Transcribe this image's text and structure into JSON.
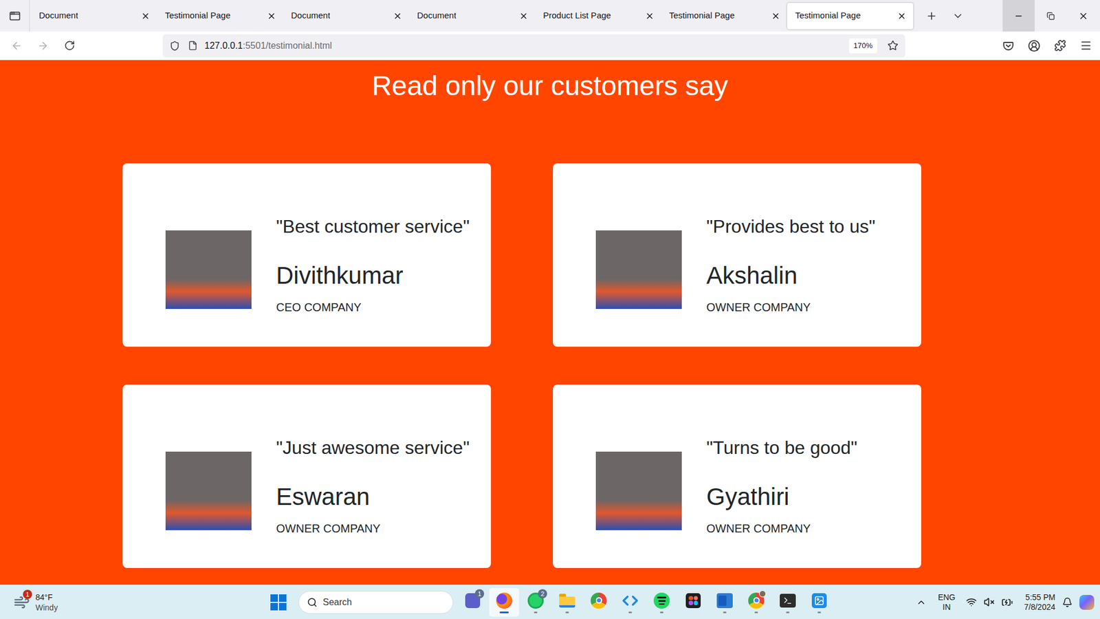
{
  "browser": {
    "tabs": [
      {
        "label": "Document",
        "selected": false
      },
      {
        "label": "Testimonial Page",
        "selected": false
      },
      {
        "label": "Document",
        "selected": false
      },
      {
        "label": "Document",
        "selected": false
      },
      {
        "label": "Product List Page",
        "selected": false
      },
      {
        "label": "Testimonial Page",
        "selected": false
      },
      {
        "label": "Testimonial Page",
        "selected": true
      }
    ],
    "address": {
      "host": "127.0.0.1",
      "rest": ":5501/testimonial.html"
    },
    "zoom": "170%"
  },
  "page": {
    "heading": "Read only our customers say",
    "testimonials": [
      {
        "quote": "\"Best customer service\"",
        "name": "Divithkumar",
        "role": "CEO COMPANY"
      },
      {
        "quote": "\"Provides best to us\"",
        "name": "Akshalin",
        "role": "OWNER COMPANY"
      },
      {
        "quote": "\"Just awesome service\"",
        "name": "Eswaran",
        "role": "OWNER COMPANY"
      },
      {
        "quote": "\"Turns to be good\"",
        "name": "Gyathiri",
        "role": "OWNER COMPANY"
      }
    ]
  },
  "taskbar": {
    "weather": {
      "temp": "84°F",
      "condition": "Windy",
      "badge": "1"
    },
    "search": {
      "placeholder": "Search"
    },
    "apps": [
      {
        "kind": "teams",
        "running": false,
        "active": false,
        "badge": "1"
      },
      {
        "kind": "firefox",
        "running": true,
        "active": true
      },
      {
        "kind": "whatsapp",
        "running": true,
        "active": false,
        "badge": "2"
      },
      {
        "kind": "explorer",
        "running": true,
        "active": false
      },
      {
        "kind": "chrome",
        "running": false,
        "active": false
      },
      {
        "kind": "vscode",
        "running": true,
        "active": false
      },
      {
        "kind": "spotify",
        "running": true,
        "active": false
      },
      {
        "kind": "figma",
        "running": false,
        "active": false
      },
      {
        "kind": "word",
        "running": true,
        "active": false
      },
      {
        "kind": "chromeprofile",
        "running": true,
        "active": false
      },
      {
        "kind": "terminal",
        "running": true,
        "active": false
      },
      {
        "kind": "paint",
        "running": true,
        "active": false
      }
    ],
    "language": {
      "line1": "ENG",
      "line2": "IN"
    },
    "muted": true,
    "charging": true,
    "clock": {
      "time": "5:55 PM",
      "date": "7/8/2024"
    }
  }
}
